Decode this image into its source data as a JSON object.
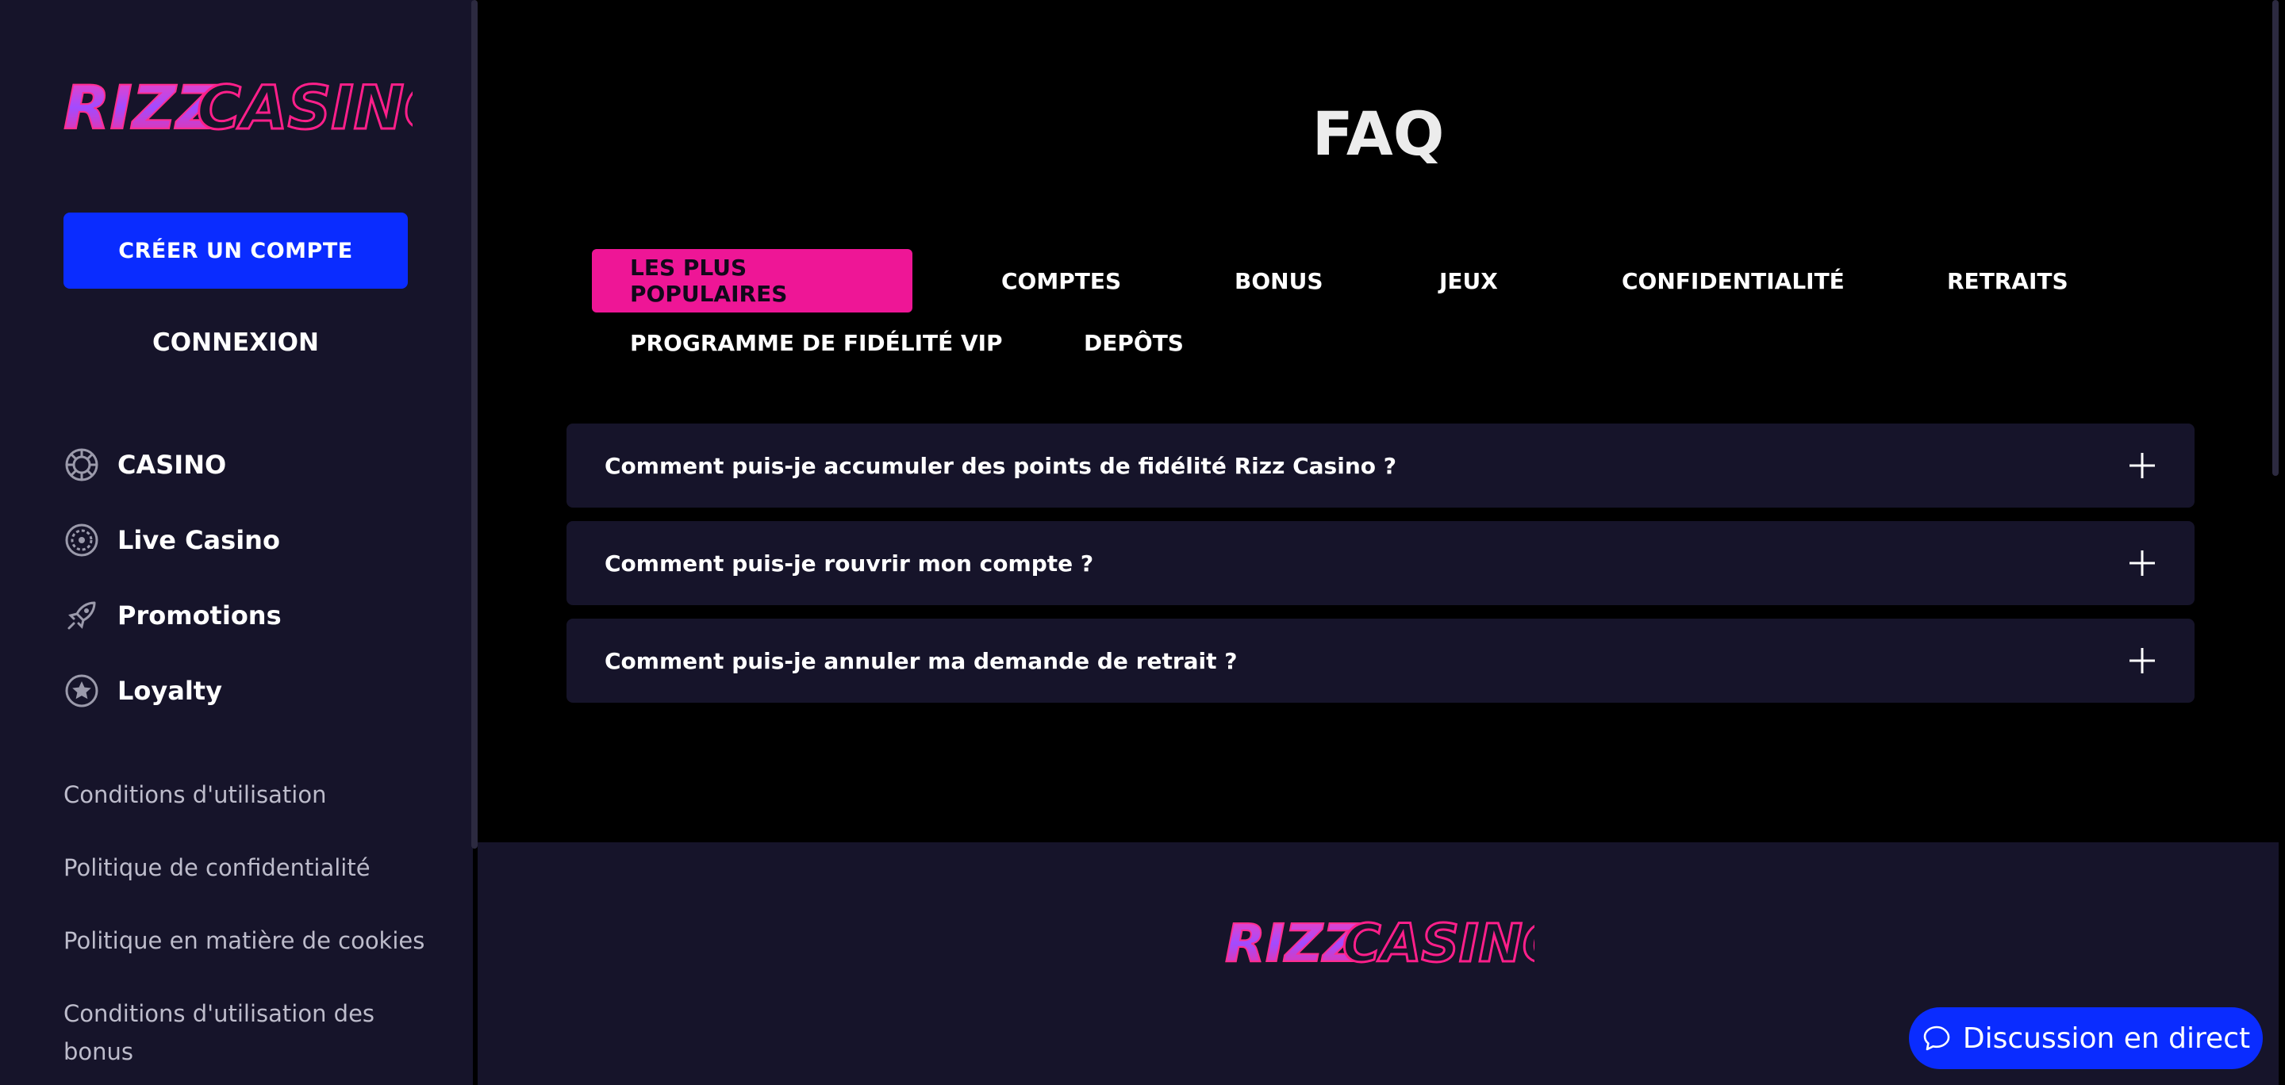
{
  "brand": {
    "name_part1": "RIZZ",
    "name_part2": "CASINO",
    "colors": {
      "primary_blue": "#0a2cff",
      "accent_pink": "#ee1696",
      "panel": "#16142a"
    }
  },
  "sidebar": {
    "create_account_label": "CRÉER UN COMPTE",
    "login_label": "CONNEXION",
    "nav": [
      {
        "label": "CASINO",
        "icon": "chip-icon"
      },
      {
        "label": "Live Casino",
        "icon": "roulette-icon"
      },
      {
        "label": "Promotions",
        "icon": "rocket-icon"
      },
      {
        "label": "Loyalty",
        "icon": "star-icon"
      }
    ],
    "links": [
      "Conditions d'utilisation",
      "Politique de confidentialité",
      "Politique en matière de cookies",
      "Conditions d'utilisation des bonus"
    ]
  },
  "main": {
    "title": "FAQ",
    "tabs": [
      {
        "label": "LES PLUS POPULAIRES",
        "active": true
      },
      {
        "label": "COMPTES"
      },
      {
        "label": "BONUS"
      },
      {
        "label": "JEUX"
      },
      {
        "label": "CONFIDENTIALITÉ"
      },
      {
        "label": "RETRAITS"
      },
      {
        "label": "PROGRAMME DE FIDÉLITÉ VIP"
      },
      {
        "label": "DEPÔTS"
      }
    ],
    "faq": [
      "Comment puis-je accumuler des points de fidélité Rizz Casino ?",
      "Comment puis-je rouvrir mon compte ?",
      "Comment puis-je annuler ma demande de retrait ?"
    ]
  },
  "chat": {
    "label": "Discussion en direct",
    "icon": "chat-bubble-icon"
  }
}
